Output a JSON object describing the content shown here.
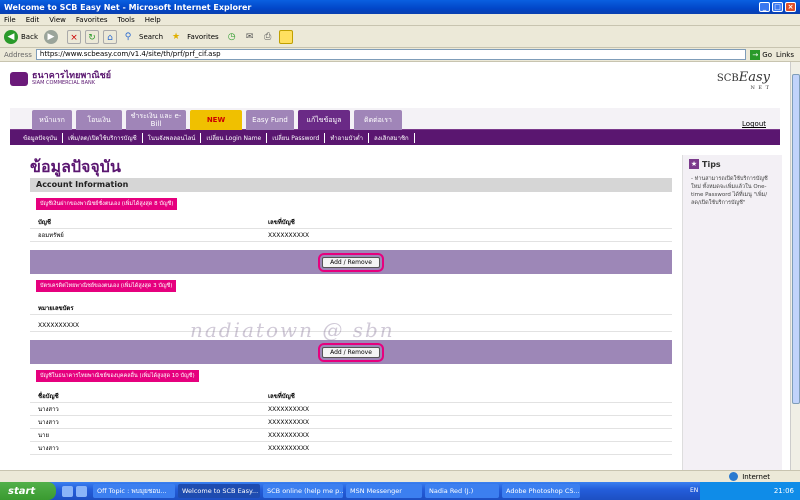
{
  "window": {
    "title": "Welcome to SCB Easy Net - Microsoft Internet Explorer"
  },
  "menu": [
    "File",
    "Edit",
    "View",
    "Favorites",
    "Tools",
    "Help"
  ],
  "toolbar": {
    "back": "Back",
    "search": "Search",
    "favorites": "Favorites"
  },
  "address": {
    "label": "Address",
    "url": "https://www.scbeasy.com/v1.4/site/th/prf/prf_cif.asp",
    "go": "Go",
    "links": "Links"
  },
  "brand": {
    "bank_name": "ธนาคารไทยพาณิชย์",
    "bank_sub": "SIAM COMMERCIAL BANK",
    "scb": "SCB",
    "easy": "Easy",
    "net": "N E T"
  },
  "tabs": [
    {
      "label": "หน้าแรก"
    },
    {
      "label": "โอนเงิน"
    },
    {
      "label": "ชำระเงิน และ e-Bill"
    },
    {
      "label": "NEW"
    },
    {
      "label": "Easy Fund"
    },
    {
      "label": "แก้ไขข้อมูล"
    },
    {
      "label": "ติดต่อเรา"
    }
  ],
  "logout": "Logout",
  "subnav": [
    "ข้อมูลปัจจุบัน",
    "เพิ่ม/ลด/เปิดใช้บริการบัญชี",
    "โนนจังพลลอนไลน์",
    "เปลี่ยน Login Name",
    "เปลี่ยน Password",
    "ทำอามบัวต่ำ",
    "ลงเลิกสมาชิก"
  ],
  "page_title": "ข้อมูลปัจจุบัน",
  "panel": {
    "header": "Account Information",
    "section1": {
      "label": "บัญชีเงินฝากของพาณิชย์ชั่งตนเอง (เพิ่มได้สูงสุด 8 บัญชี)",
      "col1": "บัญชี",
      "col2": "เลขที่บัญชี",
      "rows": [
        {
          "c1": "ออมทรัพย์",
          "c2": "XXXXXXXXXX"
        }
      ]
    },
    "add_remove": "Add / Remove",
    "section2": {
      "label": "บัตรเครดิตไทยพาณิชย์ของตนเอง (เพิ่มได้สูงสุด 3 บัญชี)",
      "col1": "หมายเลขบัตร",
      "rows": [
        {
          "c1": "XXXXXXXXXX"
        }
      ]
    },
    "section3": {
      "label": "บัญชีในธนาคารไทยพาณิชย์ของบุคคลอื่น (เพิ่มได้สูงสุด 10 บัญชี)",
      "col1": "ชื่อบัญชี",
      "col2": "เลขที่บัญชี",
      "rows": [
        {
          "c1": "นางสาว",
          "c2": "XXXXXXXXXX"
        },
        {
          "c1": "นางสาว",
          "c2": "XXXXXXXXXX"
        },
        {
          "c1": "นาย",
          "c2": "XXXXXXXXXX"
        },
        {
          "c1": "นางสาว",
          "c2": "XXXXXXXXXX"
        }
      ]
    }
  },
  "tips": {
    "title": "Tips",
    "body": "- ท่านสามารถเปิดใช้บริการบัญชีใหม่ ทั้งหมดจะเพิ่มแล้วใน One-time Password ได้ที่เมนู \"เพิ่ม/ลด/เปิดใช้บริการบัญชี\""
  },
  "watermark": "nadiatown @ sbn",
  "status": {
    "zone": "Internet"
  },
  "taskbar": {
    "start": "start",
    "tasks": [
      {
        "label": "Off Topic : พบมุยชอบ..."
      },
      {
        "label": "Welcome to SCB Easy..."
      },
      {
        "label": "SCB online (help me p..."
      },
      {
        "label": "MSN Messenger"
      },
      {
        "label": "Nadia Red (J.)"
      },
      {
        "label": "Adobe Photoshop CS..."
      }
    ],
    "lang": "EN",
    "time": "21:06"
  }
}
